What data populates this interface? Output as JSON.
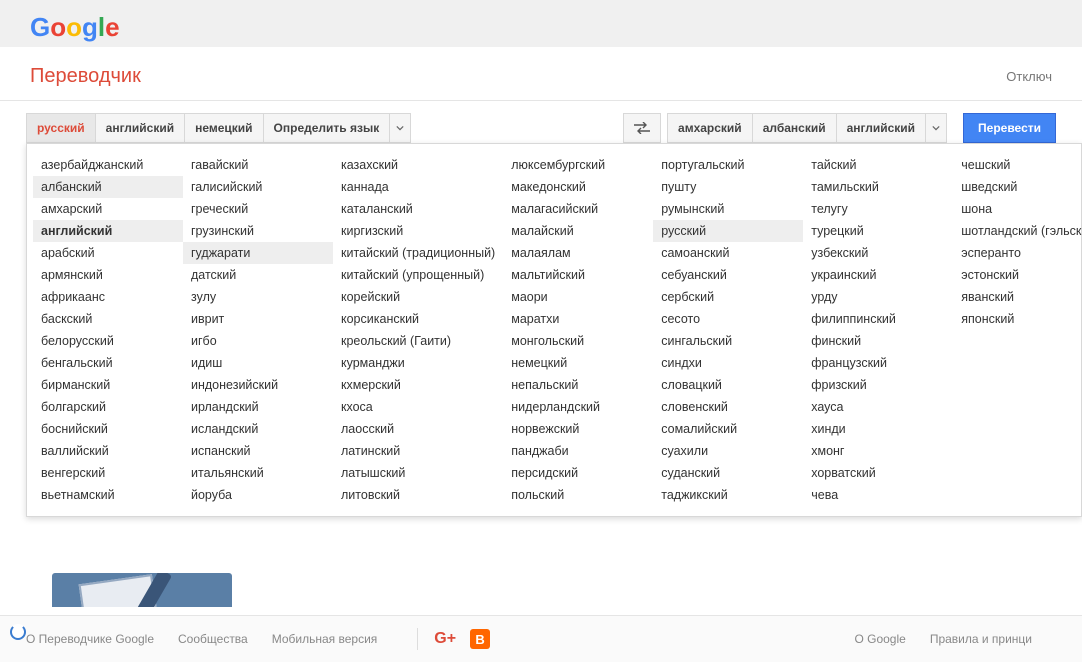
{
  "logo": {
    "g1": "G",
    "o1": "o",
    "o2": "o",
    "g2": "g",
    "l1": "l",
    "e1": "e"
  },
  "title": "Переводчик",
  "top_right": "Отключ",
  "source_tabs": [
    "русский",
    "английский",
    "немецкий",
    "Определить язык"
  ],
  "source_active_index": 0,
  "target_tabs": [
    "амхарский",
    "албанский",
    "английский"
  ],
  "translate_btn": "Перевести",
  "lang_columns": [
    [
      "азербайджанский",
      "албанский",
      "амхарский",
      "английский",
      "арабский",
      "армянский",
      "африкаанс",
      "баскский",
      "белорусский",
      "бенгальский",
      "бирманский",
      "болгарский",
      "боснийский",
      "валлийский",
      "венгерский",
      "вьетнамский"
    ],
    [
      "гавайский",
      "галисийский",
      "греческий",
      "грузинский",
      "гуджарати",
      "датский",
      "зулу",
      "иврит",
      "игбо",
      "идиш",
      "индонезийский",
      "ирландский",
      "исландский",
      "испанский",
      "итальянский",
      "йоруба"
    ],
    [
      "казахский",
      "каннада",
      "каталанский",
      "киргизский",
      "китайский (традиционный)",
      "китайский (упрощенный)",
      "корейский",
      "корсиканский",
      "креольский (Гаити)",
      "курманджи",
      "кхмерский",
      "кхоса",
      "лаосский",
      "латинский",
      "латышский",
      "литовский"
    ],
    [
      "люксембургский",
      "македонский",
      "малагасийский",
      "малайский",
      "малаялам",
      "мальтийский",
      "маори",
      "маратхи",
      "монгольский",
      "немецкий",
      "непальский",
      "нидерландский",
      "норвежский",
      "панджаби",
      "персидский",
      "польский"
    ],
    [
      "португальский",
      "пушту",
      "румынский",
      "русский",
      "самоанский",
      "себуанский",
      "сербский",
      "сесото",
      "сингальский",
      "синдхи",
      "словацкий",
      "словенский",
      "сомалийский",
      "суахили",
      "суданский",
      "таджикский"
    ],
    [
      "тайский",
      "тамильский",
      "телугу",
      "турецкий",
      "узбекский",
      "украинский",
      "урду",
      "филиппинский",
      "финский",
      "французский",
      "фризский",
      "хауса",
      "хинди",
      "хмонг",
      "хорватский",
      "чева"
    ],
    [
      "чешский",
      "шведский",
      "шона",
      "шотландский (гэльский)",
      "эсперанто",
      "эстонский",
      "яванский",
      "японский"
    ]
  ],
  "highlighted": [
    "албанский",
    "английский",
    "гуджарати",
    "русский"
  ],
  "selected": "английский",
  "footer": {
    "about": "О Переводчике Google",
    "communities": "Сообщества",
    "mobile": "Мобильная версия",
    "about_google": "О Google",
    "policies": "Правила и принци"
  }
}
